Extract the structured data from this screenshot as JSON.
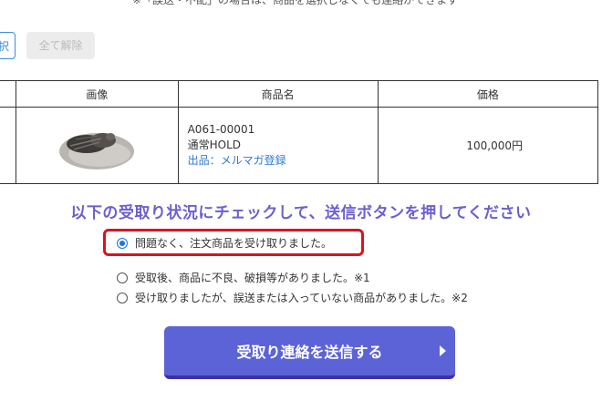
{
  "top_note": "※「誤送・不配」の場合は、商品を選択しなくても連絡ができます",
  "buttons": {
    "partial_label": "択",
    "clear_all_label": "全て解除"
  },
  "table": {
    "headers": [
      "",
      "画像",
      "商品名",
      "価格"
    ],
    "rows": [
      {
        "image_icon": "trilobite-fossil-photo",
        "item_code": "A061-00001",
        "item_name": "通常HOLD",
        "listing_link": "出品：メルマガ登録",
        "price": "100,000円"
      }
    ]
  },
  "instruction": "以下の受取り状況にチェックして、送信ボタンを押してください",
  "options": [
    {
      "label": "問題なく、注文商品を受け取りました。",
      "checked": true
    },
    {
      "label": "受取後、商品に不良、破損等がありました。※1",
      "checked": false
    },
    {
      "label": "受け取りましたが、誤送または入っていない商品がありました。※2",
      "checked": false
    }
  ],
  "submit_label": "受取り連絡を送信する",
  "colors": {
    "accent": "#5b63d6",
    "instruction": "#6b5fd0",
    "highlight": "#e0101e",
    "link": "#2e7ad6"
  }
}
